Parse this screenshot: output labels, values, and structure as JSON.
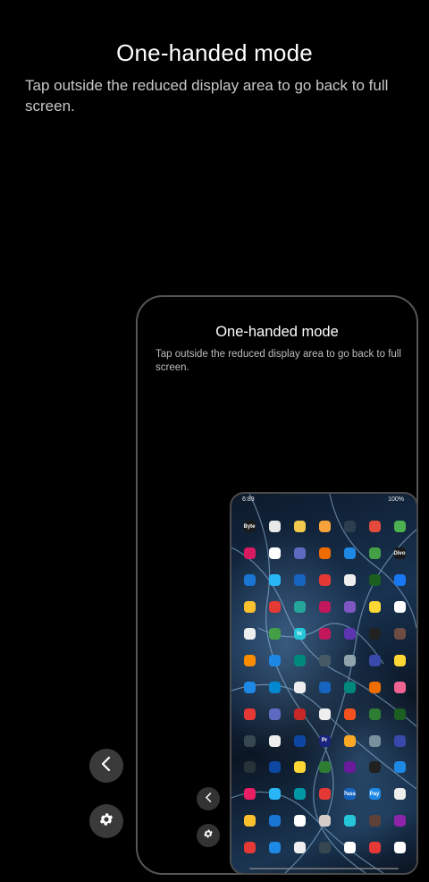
{
  "screen": {
    "title": "One-handed mode",
    "description": "Tap outside the reduced display area to go back to full screen."
  },
  "preview": {
    "title": "One-handed mode",
    "description": "Tap outside the reduced display area to go back to full screen.",
    "status_time": "6:89",
    "status_battery": "100%"
  },
  "controls": {
    "back_icon": "chevron-left-icon",
    "settings_icon": "gear-icon"
  },
  "colors": {
    "background": "#000000",
    "button": "#3a3a3a",
    "frame": "#555555"
  },
  "apps": [
    {
      "c": "#1a1a1a",
      "t": "Byte"
    },
    {
      "c": "#e8e8e8",
      "t": ""
    },
    {
      "c": "#f2c94c",
      "t": ""
    },
    {
      "c": "#f7a23b",
      "t": ""
    },
    {
      "c": "#2d3e50",
      "t": ""
    },
    {
      "c": "#e34a3b",
      "t": ""
    },
    {
      "c": "#4caf50",
      "t": ""
    },
    {
      "c": "#d81b60",
      "t": ""
    },
    {
      "c": "#ffffff",
      "t": ""
    },
    {
      "c": "#5c6bc0",
      "t": ""
    },
    {
      "c": "#ef6c00",
      "t": ""
    },
    {
      "c": "#1e88e5",
      "t": ""
    },
    {
      "c": "#43a047",
      "t": ""
    },
    {
      "c": "#1a1a1a",
      "t": "Divo"
    },
    {
      "c": "#1976d2",
      "t": ""
    },
    {
      "c": "#29b6f6",
      "t": ""
    },
    {
      "c": "#1565c0",
      "t": ""
    },
    {
      "c": "#e53935",
      "t": ""
    },
    {
      "c": "#eeeeee",
      "t": ""
    },
    {
      "c": "#1b5e20",
      "t": ""
    },
    {
      "c": "#1877f2",
      "t": ""
    },
    {
      "c": "#fbc02d",
      "t": ""
    },
    {
      "c": "#e53935",
      "t": ""
    },
    {
      "c": "#26a69a",
      "t": ""
    },
    {
      "c": "#c2185b",
      "t": ""
    },
    {
      "c": "#7e57c2",
      "t": ""
    },
    {
      "c": "#fdd835",
      "t": ""
    },
    {
      "c": "#ffffff",
      "t": ""
    },
    {
      "c": "#eeeeee",
      "t": ""
    },
    {
      "c": "#43a047",
      "t": ""
    },
    {
      "c": "#26c6da",
      "t": "hi"
    },
    {
      "c": "#c2185b",
      "t": ""
    },
    {
      "c": "#5e35b1",
      "t": ""
    },
    {
      "c": "#212121",
      "t": ""
    },
    {
      "c": "#6d4c41",
      "t": ""
    },
    {
      "c": "#fb8c00",
      "t": ""
    },
    {
      "c": "#1e88e5",
      "t": ""
    },
    {
      "c": "#00897b",
      "t": ""
    },
    {
      "c": "#455a64",
      "t": ""
    },
    {
      "c": "#90a4ae",
      "t": ""
    },
    {
      "c": "#3949ab",
      "t": ""
    },
    {
      "c": "#fdd835",
      "t": ""
    },
    {
      "c": "#1e88e5",
      "t": ""
    },
    {
      "c": "#0288d1",
      "t": ""
    },
    {
      "c": "#eeeeee",
      "t": ""
    },
    {
      "c": "#1565c0",
      "t": ""
    },
    {
      "c": "#00897b",
      "t": ""
    },
    {
      "c": "#ef6c00",
      "t": ""
    },
    {
      "c": "#f06292",
      "t": ""
    },
    {
      "c": "#e53935",
      "t": ""
    },
    {
      "c": "#5c6bc0",
      "t": ""
    },
    {
      "c": "#c62828",
      "t": ""
    },
    {
      "c": "#eeeeee",
      "t": ""
    },
    {
      "c": "#f4511e",
      "t": ""
    },
    {
      "c": "#2e7d32",
      "t": ""
    },
    {
      "c": "#1b5e20",
      "t": ""
    },
    {
      "c": "#37474f",
      "t": ""
    },
    {
      "c": "#eeeeee",
      "t": ""
    },
    {
      "c": "#0d47a1",
      "t": ""
    },
    {
      "c": "#1a237e",
      "t": "Pr"
    },
    {
      "c": "#f9a825",
      "t": ""
    },
    {
      "c": "#78909c",
      "t": ""
    },
    {
      "c": "#3949ab",
      "t": ""
    },
    {
      "c": "#263238",
      "t": ""
    },
    {
      "c": "#0d47a1",
      "t": ""
    },
    {
      "c": "#fdd835",
      "t": ""
    },
    {
      "c": "#2e7d32",
      "t": ""
    },
    {
      "c": "#6a1b9a",
      "t": ""
    },
    {
      "c": "#212121",
      "t": ""
    },
    {
      "c": "#1e88e5",
      "t": ""
    },
    {
      "c": "#e91e63",
      "t": ""
    },
    {
      "c": "#29b6f6",
      "t": ""
    },
    {
      "c": "#0097a7",
      "t": ""
    },
    {
      "c": "#e53935",
      "t": ""
    },
    {
      "c": "#1565c0",
      "t": "Pass"
    },
    {
      "c": "#1e88e5",
      "t": "Pay"
    },
    {
      "c": "#eeeeee",
      "t": ""
    },
    {
      "c": "#fbc02d",
      "t": ""
    },
    {
      "c": "#1976d2",
      "t": ""
    },
    {
      "c": "#ffffff",
      "t": ""
    },
    {
      "c": "#d7ccc8",
      "t": ""
    },
    {
      "c": "#26c6da",
      "t": ""
    },
    {
      "c": "#5d4037",
      "t": ""
    },
    {
      "c": "#8e24aa",
      "t": ""
    },
    {
      "c": "#e53935",
      "t": ""
    },
    {
      "c": "#1e88e5",
      "t": ""
    },
    {
      "c": "#eeeeee",
      "t": ""
    },
    {
      "c": "#37474f",
      "t": ""
    },
    {
      "c": "#ffffff",
      "t": ""
    },
    {
      "c": "#e53935",
      "t": ""
    },
    {
      "c": "#ffffff",
      "t": ""
    }
  ]
}
